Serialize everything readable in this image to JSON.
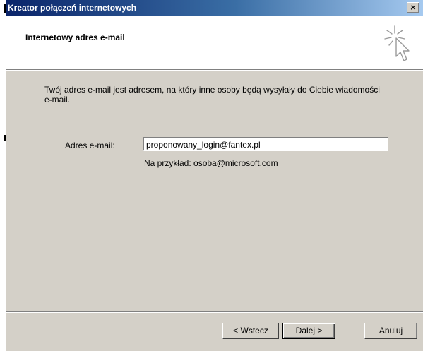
{
  "window": {
    "title": "Kreator połączeń internetowych",
    "close_label": "×"
  },
  "header": {
    "title": "Internetowy adres e-mail",
    "icon": "wizard-cursor-sparkle-icon"
  },
  "main": {
    "description": "Twój adres e-mail jest adresem, na który inne osoby będą wysyłały do Ciebie wiadomości e-mail.",
    "email_label": "Adres e-mail:",
    "email_value": "proponowany_login@fantex.pl",
    "example": "Na przykład: osoba@microsoft.com"
  },
  "buttons": {
    "back": "< Wstecz",
    "next": "Dalej >",
    "cancel": "Anuluj"
  },
  "colors": {
    "title_bar_start": "#0a246a",
    "title_bar_end": "#a6caf0",
    "dialog_face": "#d4d0c8",
    "header_background": "#ffffff"
  }
}
